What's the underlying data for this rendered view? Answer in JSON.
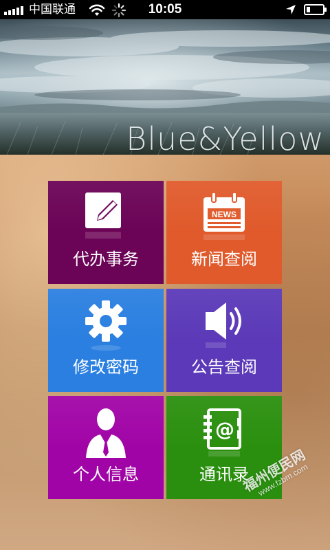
{
  "status_bar": {
    "carrier": "中国联通",
    "time": "10:05",
    "signal_bars": 5,
    "icons": [
      "signal-icon",
      "wifi-icon",
      "loading-spinner-icon",
      "location-arrow-icon",
      "battery-icon"
    ]
  },
  "banner": {
    "title": "Blue&Yellow"
  },
  "tiles": [
    {
      "label": "代办事务",
      "icon": "edit-document-icon",
      "color": "#6b0356"
    },
    {
      "label": "新闻查阅",
      "icon": "news-calendar-icon",
      "icon_text": "NEWS",
      "color": "#e05a2b"
    },
    {
      "label": "修改密码",
      "icon": "gear-icon",
      "color": "#2a7fe0"
    },
    {
      "label": "公告查阅",
      "icon": "speaker-icon",
      "color": "#5b39b8"
    },
    {
      "label": "个人信息",
      "icon": "user-icon",
      "color": "#a104a6"
    },
    {
      "label": "通讯录",
      "icon": "address-book-icon",
      "icon_text": "@",
      "color": "#2a8f0e"
    }
  ],
  "watermark": {
    "name": "福州便民网",
    "url": "www.fzbm.com"
  }
}
